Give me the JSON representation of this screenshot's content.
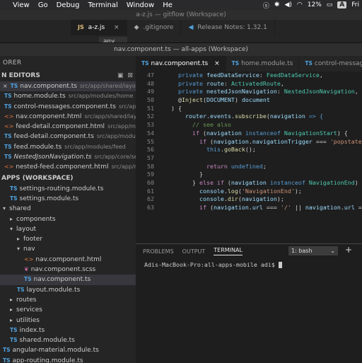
{
  "menubar": {
    "items": [
      "",
      "View",
      "Go",
      "Debug",
      "Terminal",
      "Window",
      "He"
    ],
    "battery": "12%",
    "user_initial": "A",
    "fri": "Fri"
  },
  "back_window": {
    "title": "a-z.js — gitflow (Workspace)",
    "tabs": [
      {
        "icon": "JS",
        "label": "a-z.js",
        "active": true
      },
      {
        "icon": "",
        "label": ".gitignore",
        "active": false
      },
      {
        "icon": "",
        "label": "Release Notes: 1.32.1",
        "active": false
      }
    ],
    "any_label": "any"
  },
  "window": {
    "title": "nav.component.ts — all-apps (Workspace)"
  },
  "sidebar": {
    "header": "ORER",
    "open_editors_label": "N EDITORS",
    "open_editors": [
      {
        "icon": "TS",
        "name": "nav.component.ts",
        "path": "src/app/shared/layout/nav",
        "sel": true,
        "close": true
      },
      {
        "icon": "TS",
        "name": "home.module.ts",
        "path": "src/app/modules/home"
      },
      {
        "icon": "TS",
        "name": "control-messages.component.ts",
        "path": "src/app/share..."
      },
      {
        "icon": "html",
        "name": "nav.component.html",
        "path": "src/app/shared/layout/nav"
      },
      {
        "icon": "html",
        "name": "feed-detail.component.html",
        "path": "src/app/modules/f..."
      },
      {
        "icon": "TS",
        "name": "feed-detail.component.ts",
        "path": "src/app/modules/feed..."
      },
      {
        "icon": "TS",
        "name": "feed.module.ts",
        "path": "src/app/modules/feed"
      },
      {
        "icon": "TS",
        "name": "NestedJsonNavigation.ts",
        "path": "src/app/core/settings",
        "italic": true
      },
      {
        "icon": "html",
        "name": "nested-feed.component.html",
        "path": "src/app/modules/..."
      }
    ],
    "workspace_label": "APPS (WORKSPACE)",
    "tree": [
      {
        "indent": 1,
        "icon": "TS",
        "name": "settings-routing.module.ts"
      },
      {
        "indent": 1,
        "icon": "TS",
        "name": "settings.module.ts"
      },
      {
        "indent": 0,
        "arrow": "▾",
        "name": "shared"
      },
      {
        "indent": 1,
        "arrow": "▸",
        "name": "components"
      },
      {
        "indent": 1,
        "arrow": "▾",
        "name": "layout"
      },
      {
        "indent": 2,
        "arrow": "▸",
        "name": "footer"
      },
      {
        "indent": 2,
        "arrow": "▾",
        "name": "nav"
      },
      {
        "indent": 3,
        "icon": "html",
        "name": "nav.component.html"
      },
      {
        "indent": 3,
        "icon": "scss",
        "name": "nav.component.scss"
      },
      {
        "indent": 3,
        "icon": "TS",
        "name": "nav.component.ts",
        "sel": true
      },
      {
        "indent": 2,
        "icon": "TS",
        "name": "layout.module.ts"
      },
      {
        "indent": 1,
        "arrow": "▸",
        "name": "routes"
      },
      {
        "indent": 1,
        "arrow": "▸",
        "name": "services"
      },
      {
        "indent": 1,
        "arrow": "▸",
        "name": "utilities"
      },
      {
        "indent": 1,
        "icon": "TS",
        "name": "index.ts"
      },
      {
        "indent": 1,
        "icon": "TS",
        "name": "shared.module.ts"
      },
      {
        "indent": 0,
        "icon": "TS",
        "name": "angular-material.module.ts"
      },
      {
        "indent": 0,
        "icon": "TS",
        "name": "app-routing.module.ts"
      }
    ]
  },
  "editor": {
    "tabs": [
      {
        "icon": "TS",
        "label": "nav.component.ts",
        "active": true,
        "close": true
      },
      {
        "icon": "TS",
        "label": "home.module.ts",
        "active": false
      },
      {
        "icon": "TS",
        "label": "control-messages.comp",
        "active": false
      }
    ],
    "lines": [
      {
        "n": "47",
        "tokens": [
          [
            "    ",
            "pl"
          ],
          [
            "private ",
            "kw"
          ],
          [
            "feedDataService",
            "va"
          ],
          [
            ": ",
            "pl"
          ],
          [
            "FeedDataService",
            "ty"
          ],
          [
            ",",
            "pl"
          ]
        ]
      },
      {
        "n": "48",
        "tokens": [
          [
            "    ",
            "pl"
          ],
          [
            "private ",
            "kw"
          ],
          [
            "route",
            "va"
          ],
          [
            ": ",
            "pl"
          ],
          [
            "ActivatedRoute",
            "ty"
          ],
          [
            ",",
            "pl"
          ]
        ]
      },
      {
        "n": "49",
        "tokens": [
          [
            "    ",
            "pl"
          ],
          [
            "private ",
            "kw"
          ],
          [
            "nestedJsonNavigation",
            "va"
          ],
          [
            ": ",
            "pl"
          ],
          [
            "NestedJsonNavigation",
            "ty"
          ],
          [
            ",",
            "pl"
          ]
        ]
      },
      {
        "n": "50",
        "tokens": [
          [
            "    ",
            "pl"
          ],
          [
            "@",
            "pl"
          ],
          [
            "Inject",
            "fn"
          ],
          [
            "(",
            "pl"
          ],
          [
            "DOCUMENT",
            "va"
          ],
          [
            ") ",
            "pl"
          ],
          [
            "document",
            "va"
          ]
        ]
      },
      {
        "n": "51",
        "tokens": [
          [
            "  ) {",
            "pl"
          ]
        ]
      },
      {
        "n": "52",
        "tokens": [
          [
            "      ",
            "pl"
          ],
          [
            "router",
            "va"
          ],
          [
            ".",
            "pl"
          ],
          [
            "events",
            "va"
          ],
          [
            ".",
            "pl"
          ],
          [
            "subscribe",
            "fn"
          ],
          [
            "(",
            "pl"
          ],
          [
            "navigation",
            "va"
          ],
          [
            " => {",
            "kw"
          ]
        ]
      },
      {
        "n": "53",
        "tokens": [
          [
            "        ",
            "pl"
          ],
          [
            "// see also",
            "cm"
          ]
        ]
      },
      {
        "n": "54",
        "tokens": [
          [
            "        ",
            "pl"
          ],
          [
            "if ",
            "ctl"
          ],
          [
            "(",
            "pl"
          ],
          [
            "navigation ",
            "va"
          ],
          [
            "instanceof ",
            "kw"
          ],
          [
            "NavigationStart",
            "ty"
          ],
          [
            ") {",
            "pl"
          ]
        ]
      },
      {
        "n": "55",
        "tokens": [
          [
            "          ",
            "pl"
          ],
          [
            "if ",
            "ctl"
          ],
          [
            "(",
            "pl"
          ],
          [
            "navigation",
            "va"
          ],
          [
            ".",
            "pl"
          ],
          [
            "navigationTrigger",
            "va"
          ],
          [
            " === ",
            "pl"
          ],
          [
            "'popstate'",
            "st"
          ],
          [
            ") {",
            "pl"
          ]
        ]
      },
      {
        "n": "56",
        "tokens": [
          [
            "            ",
            "pl"
          ],
          [
            "this",
            "kw"
          ],
          [
            ".",
            "pl"
          ],
          [
            "goBack",
            "fn"
          ],
          [
            "();",
            "pl"
          ]
        ]
      },
      {
        "n": "57",
        "tokens": []
      },
      {
        "n": "58",
        "tokens": [
          [
            "            ",
            "pl"
          ],
          [
            "return ",
            "ctl"
          ],
          [
            "undefined",
            "kw"
          ],
          [
            ";",
            "pl"
          ]
        ]
      },
      {
        "n": "59",
        "tokens": [
          [
            "          }",
            "pl"
          ]
        ]
      },
      {
        "n": "60",
        "tokens": [
          [
            "        } ",
            "pl"
          ],
          [
            "else if ",
            "ctl"
          ],
          [
            "(",
            "pl"
          ],
          [
            "navigation ",
            "va"
          ],
          [
            "instanceof ",
            "kw"
          ],
          [
            "NavigationEnd",
            "ty"
          ],
          [
            ") {",
            "pl"
          ]
        ]
      },
      {
        "n": "61",
        "tokens": [
          [
            "          ",
            "pl"
          ],
          [
            "console",
            "va"
          ],
          [
            ".",
            "pl"
          ],
          [
            "log",
            "fn"
          ],
          [
            "(",
            "pl"
          ],
          [
            "'NavigationEnd'",
            "st"
          ],
          [
            ");",
            "pl"
          ]
        ]
      },
      {
        "n": "62",
        "tokens": [
          [
            "          ",
            "pl"
          ],
          [
            "console",
            "va"
          ],
          [
            ".",
            "pl"
          ],
          [
            "dir",
            "fn"
          ],
          [
            "(",
            "pl"
          ],
          [
            "navigation",
            "va"
          ],
          [
            ");",
            "pl"
          ]
        ]
      },
      {
        "n": "63",
        "tokens": [
          [
            "          ",
            "pl"
          ],
          [
            "if ",
            "ctl"
          ],
          [
            "(",
            "pl"
          ],
          [
            "navigation",
            "va"
          ],
          [
            ".",
            "pl"
          ],
          [
            "url",
            "va"
          ],
          [
            " === ",
            "pl"
          ],
          [
            "'/'",
            "st"
          ],
          [
            " || ",
            "pl"
          ],
          [
            "navigation",
            "va"
          ],
          [
            ".",
            "pl"
          ],
          [
            "url",
            "va"
          ],
          [
            " === '",
            "pl"
          ]
        ]
      }
    ]
  },
  "panel": {
    "tabs": [
      {
        "label": "PROBLEMS",
        "active": false
      },
      {
        "label": "OUTPUT",
        "active": false
      },
      {
        "label": "TERMINAL",
        "active": true
      }
    ],
    "terminal_select": "1: bash",
    "prompt": "Adis-MacBook-Pro:all-apps-mobile adi$"
  }
}
